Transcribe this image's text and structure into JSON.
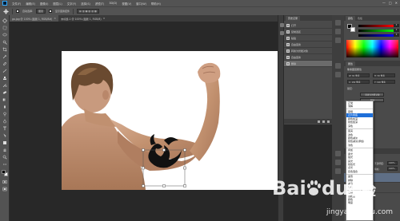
{
  "menubar": {
    "items": [
      "文件(F)",
      "编辑(E)",
      "图像(I)",
      "图层(L)",
      "文字(Y)",
      "选择(S)",
      "滤镜(T)",
      "3D(D)",
      "视图(V)",
      "窗口(W)",
      "帮助(H)"
    ],
    "window_controls": [
      "—",
      "□",
      "✕"
    ]
  },
  "optionsbar": {
    "tool_icon": "move-tool-icon",
    "auto_select_label": "自动选择:",
    "auto_select_value": "图层",
    "show_transform_label": "显示变换控件"
  },
  "tabs": [
    {
      "label": "go.jpg @ 100% (图层 1, RGB/8#)",
      "active": true
    },
    {
      "label": "未标题-1 @ 100% (图层 1, RGB/8)",
      "active": false
    }
  ],
  "history": {
    "title": "历史记录",
    "items": [
      "打开",
      "复制选区",
      "粘贴",
      "自由变换",
      "转换为智能对象",
      "自由变换",
      "删除"
    ],
    "selected_index": 6
  },
  "color": {
    "tabs": [
      "颜色",
      "色板"
    ],
    "sliders": [
      {
        "name": "R",
        "value": "0",
        "from": "#000000",
        "to": "#ff0000"
      },
      {
        "name": "G",
        "value": "0",
        "from": "#000000",
        "to": "#00ff00"
      },
      {
        "name": "B",
        "value": "0",
        "from": "#000000",
        "to": "#0000ff"
      }
    ]
  },
  "adjustments": {
    "title": "属性",
    "subtitle": "像素图层属性",
    "fields": [
      "W: 81 像素",
      "H: 50 像素",
      "X: 182 像素",
      "Y: 190 像素"
    ],
    "lock_label": "锁定:",
    "buttons": [
      "转换为智能对象",
      "删除"
    ]
  },
  "layers": {
    "title": "图层",
    "kind_label": "类型",
    "opacity_label": "不透明度:",
    "opacity_value": "100%",
    "fill_label": "填充:",
    "fill_value": "100%",
    "rows": [
      "图层 1",
      "背景"
    ]
  },
  "blend_modes": {
    "groups": [
      [
        "正常",
        "溶解"
      ],
      [
        "变暗",
        "正片叠底",
        "颜色加深",
        "线性加深",
        "深色"
      ],
      [
        "变亮",
        "滤色",
        "颜色减淡",
        "线性减淡(添加)",
        "浅色"
      ],
      [
        "叠加",
        "柔光",
        "强光",
        "亮光",
        "线性光",
        "点光",
        "实色混合"
      ],
      [
        "差值",
        "排除",
        "减去",
        "划分"
      ],
      [
        "色相",
        "饱和度",
        "颜色",
        "明度"
      ]
    ],
    "selected": "正片叠底"
  },
  "watermark": {
    "brand_bai": "Bai",
    "brand_du": "du",
    "brand_cn": "经验",
    "url": "jingyan.baidu.com"
  },
  "colors": {
    "ui_dark": "#282828",
    "panel": "#4a4a4a",
    "highlight": "#1e6fd9",
    "skin": "#c89a7e",
    "hair": "#6a4a30"
  }
}
